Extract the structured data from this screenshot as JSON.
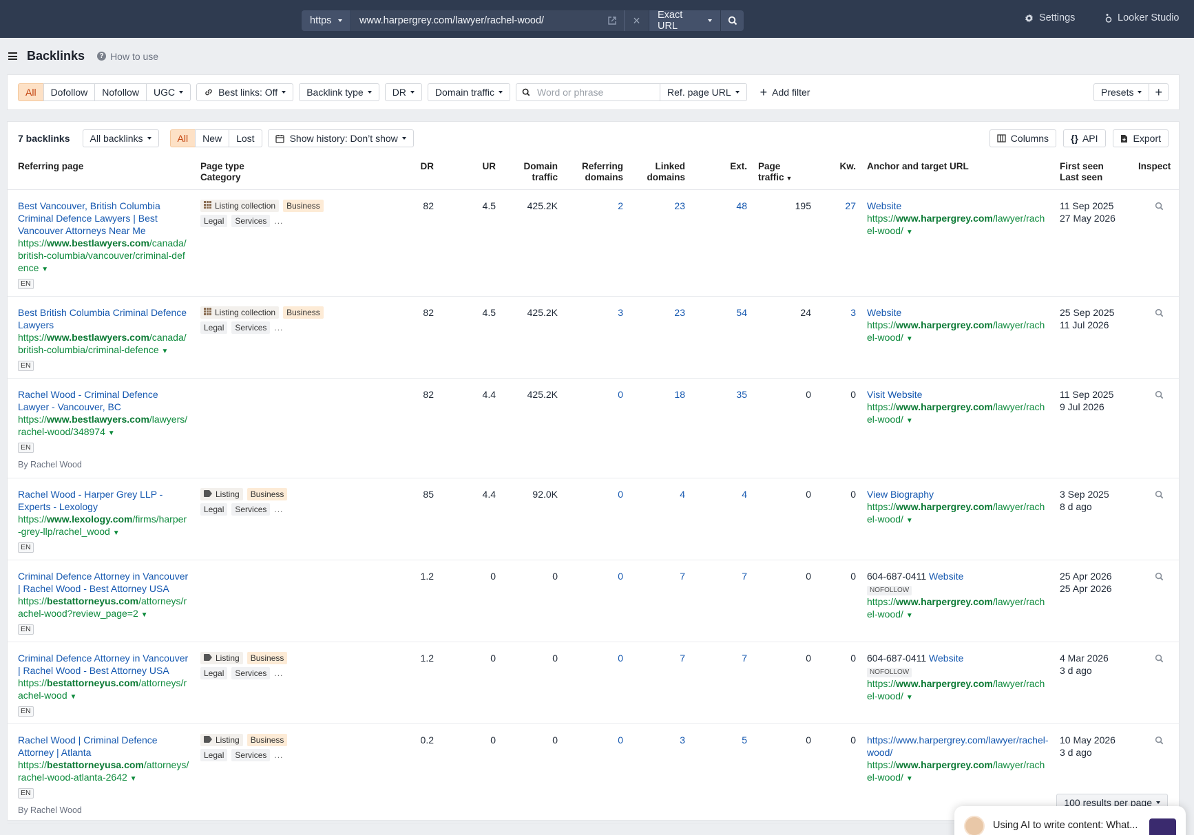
{
  "topbar": {
    "protocol": "https",
    "url": "www.harpergrey.com/lawyer/rachel-wood/",
    "mode": "Exact URL",
    "settings": "Settings",
    "looker": "Looker Studio"
  },
  "header": {
    "title": "Backlinks",
    "howto": "How to use"
  },
  "filters": {
    "types": [
      "All",
      "Dofollow",
      "Nofollow",
      "UGC"
    ],
    "best_links": "Best links: Off",
    "backlink_type": "Backlink type",
    "dr": "DR",
    "domain_traffic": "Domain traffic",
    "search_placeholder": "Word or phrase",
    "ref_page_url": "Ref. page URL",
    "add_filter": "Add filter",
    "presets": "Presets",
    "plus": "+"
  },
  "toolbar": {
    "count": "7 backlinks",
    "all_backlinks": "All backlinks",
    "states": [
      "All",
      "New",
      "Lost"
    ],
    "history": "Show history: Don’t show",
    "columns": "Columns",
    "api": "API",
    "export": "Export"
  },
  "columns": {
    "referring_page": "Referring page",
    "page_type": "Page type",
    "category": "Category",
    "dr": "DR",
    "ur": "UR",
    "domain_traffic_1": "Domain",
    "domain_traffic_2": "traffic",
    "ref_domains_1": "Referring",
    "ref_domains_2": "domains",
    "linked_domains_1": "Linked",
    "linked_domains_2": "domains",
    "ext": "Ext.",
    "page_traffic": "Page traffic",
    "kw": "Kw.",
    "anchor": "Anchor and target URL",
    "first_seen": "First seen",
    "last_seen": "Last seen",
    "inspect": "Inspect"
  },
  "rows": [
    {
      "title": "Best Vancouver, British Columbia Criminal Defence Lawyers | Best Vancouver Attorneys Near Me",
      "url_pre": "https://",
      "url_domain": "www.bestlawyers.com",
      "url_post": "/canada/british-columbia/vancouver/criminal-defence",
      "lang": "EN",
      "byline": "",
      "page_type": "Listing collection",
      "page_type_icon": "grid-icon",
      "tags": [
        "Business",
        "Legal",
        "Services"
      ],
      "dr": "82",
      "ur": "4.5",
      "domain_traffic": "425.2K",
      "ref_domains": "2",
      "linked_domains": "23",
      "ext": "48",
      "page_traffic": "195",
      "kw": "27",
      "anchor_prefix": "",
      "anchor": "Website",
      "nofollow": "",
      "target_pre": "https://",
      "target_domain": "www.harpergrey.com",
      "target_post": "/lawyer/rachel-wood/",
      "first_seen": "11 Sep 2025",
      "last_seen": "27 May 2026"
    },
    {
      "title": "Best British Columbia Criminal Defence Lawyers",
      "url_pre": "https://",
      "url_domain": "www.bestlawyers.com",
      "url_post": "/canada/british-columbia/criminal-defence",
      "lang": "EN",
      "byline": "",
      "page_type": "Listing collection",
      "page_type_icon": "grid-icon",
      "tags": [
        "Business",
        "Legal",
        "Services"
      ],
      "dr": "82",
      "ur": "4.5",
      "domain_traffic": "425.2K",
      "ref_domains": "3",
      "linked_domains": "23",
      "ext": "54",
      "page_traffic": "24",
      "kw": "3",
      "anchor_prefix": "",
      "anchor": "Website",
      "nofollow": "",
      "target_pre": "https://",
      "target_domain": "www.harpergrey.com",
      "target_post": "/lawyer/rachel-wood/",
      "first_seen": "25 Sep 2025",
      "last_seen": "11 Jul 2026"
    },
    {
      "title": "Rachel Wood - Criminal Defence Lawyer - Vancouver, BC",
      "url_pre": "https://",
      "url_domain": "www.bestlawyers.com",
      "url_post": "/lawyers/rachel-wood/348974",
      "lang": "EN",
      "byline": "By Rachel Wood",
      "page_type": "",
      "page_type_icon": "",
      "tags": [],
      "dr": "82",
      "ur": "4.4",
      "domain_traffic": "425.2K",
      "ref_domains": "0",
      "linked_domains": "18",
      "ext": "35",
      "page_traffic": "0",
      "kw": "0",
      "anchor_prefix": "",
      "anchor": "Visit Website",
      "nofollow": "",
      "target_pre": "https://",
      "target_domain": "www.harpergrey.com",
      "target_post": "/lawyer/rachel-wood/",
      "first_seen": "11 Sep 2025",
      "last_seen": "9 Jul 2026"
    },
    {
      "title": "Rachel Wood - Harper Grey LLP - Experts - Lexology",
      "url_pre": "https://",
      "url_domain": "www.lexology.com",
      "url_post": "/firms/harper-grey-llp/rachel_wood",
      "lang": "EN",
      "byline": "",
      "page_type": "Listing",
      "page_type_icon": "tag-icon",
      "tags": [
        "Business",
        "Legal",
        "Services"
      ],
      "dr": "85",
      "ur": "4.4",
      "domain_traffic": "92.0K",
      "ref_domains": "0",
      "linked_domains": "4",
      "ext": "4",
      "page_traffic": "0",
      "kw": "0",
      "anchor_prefix": "",
      "anchor": "View Biography",
      "nofollow": "",
      "target_pre": "https://",
      "target_domain": "www.harpergrey.com",
      "target_post": "/lawyer/rachel-wood/",
      "first_seen": "3 Sep 2025",
      "last_seen": "8 d ago"
    },
    {
      "title": "Criminal Defence Attorney in Vancouver | Rachel Wood - Best Attorney USA",
      "url_pre": "https://",
      "url_domain": "bestattorneyus.com",
      "url_post": "/attorneys/rachel-wood?review_page=2",
      "lang": "EN",
      "byline": "",
      "page_type": "",
      "page_type_icon": "",
      "tags": [],
      "dr": "1.2",
      "ur": "0",
      "domain_traffic": "0",
      "ref_domains": "0",
      "linked_domains": "7",
      "ext": "7",
      "page_traffic": "0",
      "kw": "0",
      "anchor_prefix": "604-687-0411",
      "anchor": "Website",
      "nofollow": "NOFOLLOW",
      "target_pre": "https://",
      "target_domain": "www.harpergrey.com",
      "target_post": "/lawyer/rachel-wood/",
      "first_seen": "25 Apr 2026",
      "last_seen": "25 Apr 2026"
    },
    {
      "title": "Criminal Defence Attorney in Vancouver | Rachel Wood - Best Attorney USA",
      "url_pre": "https://",
      "url_domain": "bestattorneyus.com",
      "url_post": "/attorneys/rachel-wood",
      "lang": "EN",
      "byline": "",
      "page_type": "Listing",
      "page_type_icon": "tag-icon",
      "tags": [
        "Business",
        "Legal",
        "Services"
      ],
      "dr": "1.2",
      "ur": "0",
      "domain_traffic": "0",
      "ref_domains": "0",
      "linked_domains": "7",
      "ext": "7",
      "page_traffic": "0",
      "kw": "0",
      "anchor_prefix": "604-687-0411",
      "anchor": "Website",
      "nofollow": "NOFOLLOW",
      "target_pre": "https://",
      "target_domain": "www.harpergrey.com",
      "target_post": "/lawyer/rachel-wood/",
      "first_seen": "4 Mar 2026",
      "last_seen": "3 d ago"
    },
    {
      "title": "Rachel Wood | Criminal Defence Attorney | Atlanta",
      "url_pre": "https://",
      "url_domain": "bestattorneyusa.com",
      "url_post": "/attorneys/rachel-wood-atlanta-2642",
      "lang": "EN",
      "byline": "By Rachel Wood",
      "page_type": "Listing",
      "page_type_icon": "tag-icon",
      "tags": [
        "Business",
        "Legal",
        "Services"
      ],
      "dr": "0.2",
      "ur": "0",
      "domain_traffic": "0",
      "ref_domains": "0",
      "linked_domains": "3",
      "ext": "5",
      "page_traffic": "0",
      "kw": "0",
      "anchor_prefix": "",
      "anchor": "https://www.harpergrey.com/lawyer/rachel-wood/",
      "nofollow": "",
      "target_pre": "https://",
      "target_domain": "www.harpergrey.com",
      "target_post": "/lawyer/rachel-wood/",
      "first_seen": "10 May 2026",
      "last_seen": "3 d ago"
    }
  ],
  "footer": {
    "per_page": "100 results per page"
  },
  "chat": {
    "text": "Using AI to write content: What..."
  },
  "colors": {
    "accent": "#f4a259",
    "link": "#1558b0",
    "url": "#0d8a3c",
    "topbar": "#2f3b50"
  }
}
